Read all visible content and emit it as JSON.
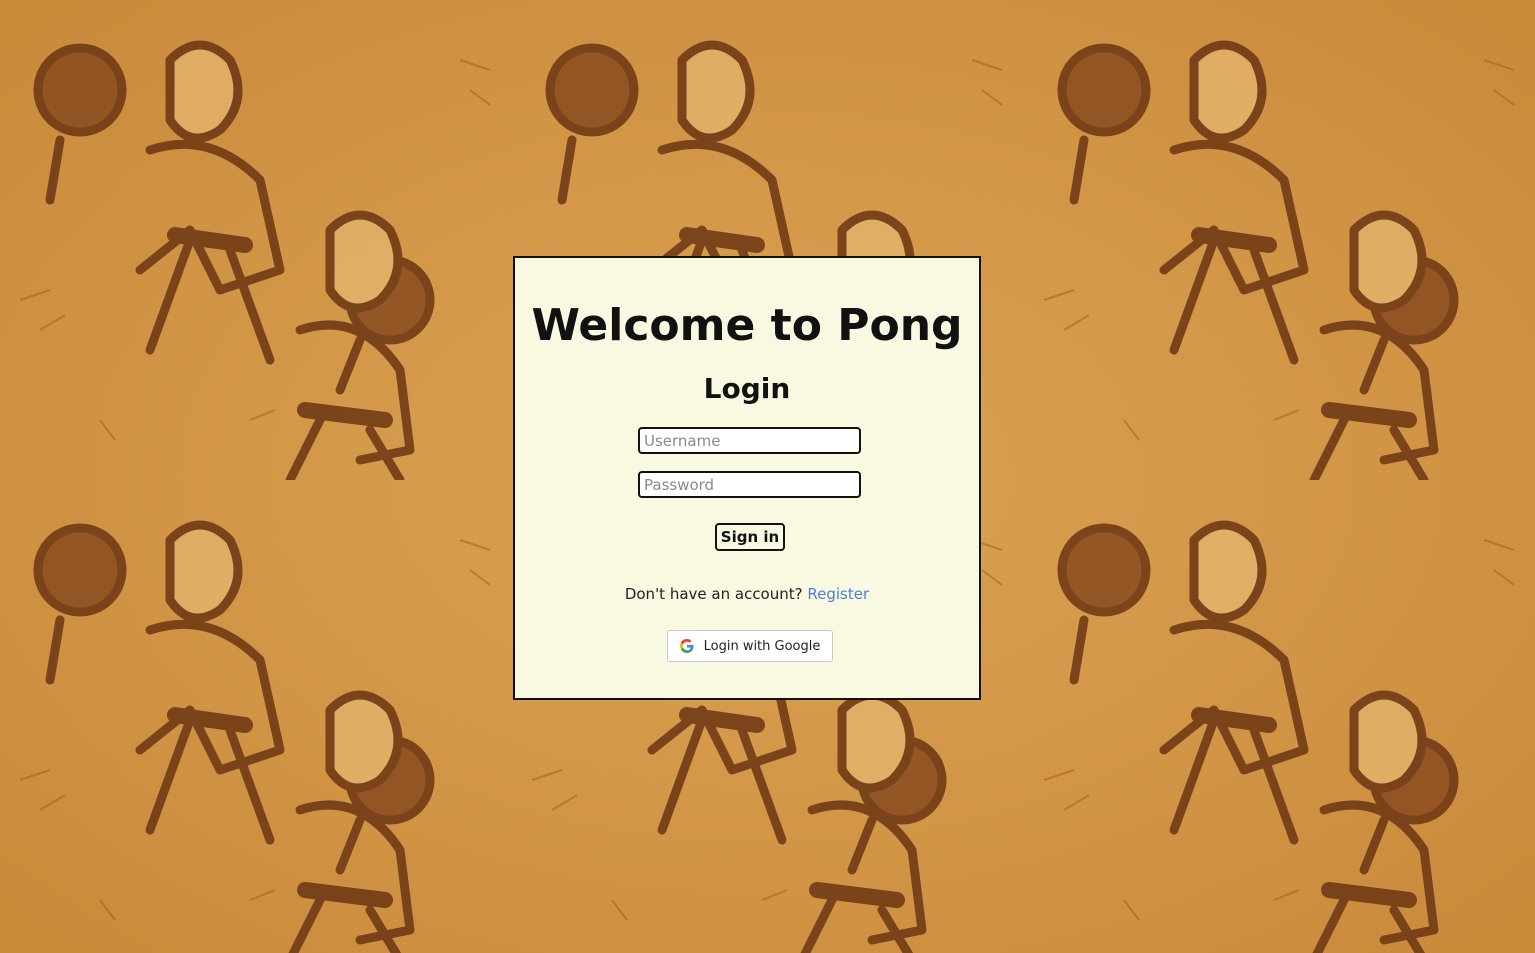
{
  "card": {
    "title": "Welcome to Pong",
    "subtitle": "Login"
  },
  "form": {
    "username": {
      "value": "",
      "placeholder": "Username"
    },
    "password": {
      "value": "",
      "placeholder": "Password"
    },
    "signin_label": "Sign in"
  },
  "register": {
    "prompt": "Don't have an account?",
    "link_label": "Register"
  },
  "google": {
    "label": "Login with Google",
    "icon": "google-g-icon"
  },
  "colors": {
    "background": "#d49a45",
    "card": "#f8f9e0",
    "link": "#4a7fd4",
    "text": "#111111"
  }
}
